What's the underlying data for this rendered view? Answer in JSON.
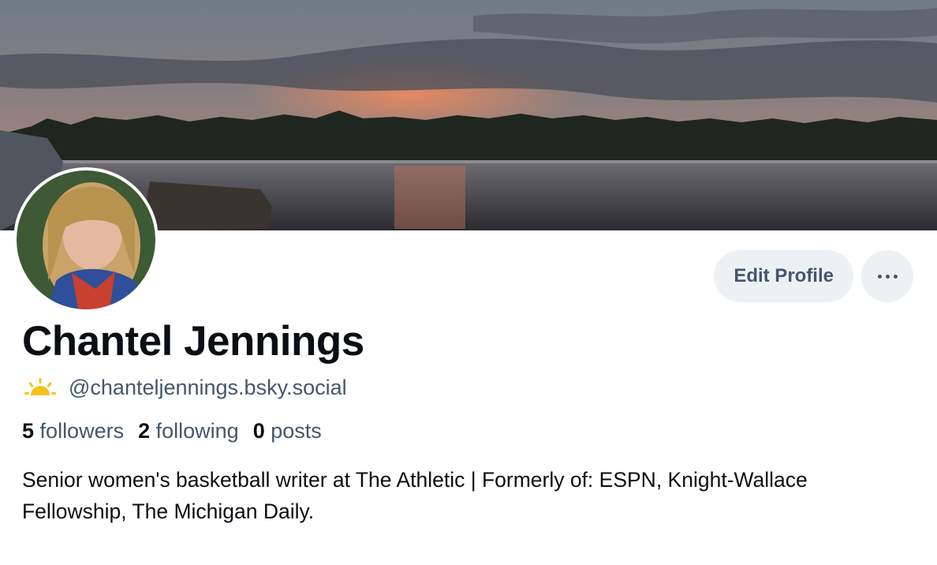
{
  "profile": {
    "display_name": "Chantel Jennings",
    "handle": "@chanteljennings.bsky.social",
    "bio": "Senior women's basketball writer at The Athletic | Formerly of: ESPN, Knight-Wallace Fellowship, The Michigan Daily.",
    "banner_image": "lake-sunset-banner",
    "avatar_image": "profile-avatar"
  },
  "stats": {
    "followers_count": "5",
    "followers_label": "followers",
    "following_count": "2",
    "following_label": "following",
    "posts_count": "0",
    "posts_label": "posts"
  },
  "actions": {
    "edit_label": "Edit Profile",
    "more_icon": "more-horizontal-icon"
  },
  "icons": {
    "handle_prefix": "sunrise-icon"
  },
  "colors": {
    "primary_text": "#0b0f14",
    "secondary_text": "#42576c",
    "button_bg": "#eef1f4",
    "sun_icon": "#f5c21b"
  }
}
